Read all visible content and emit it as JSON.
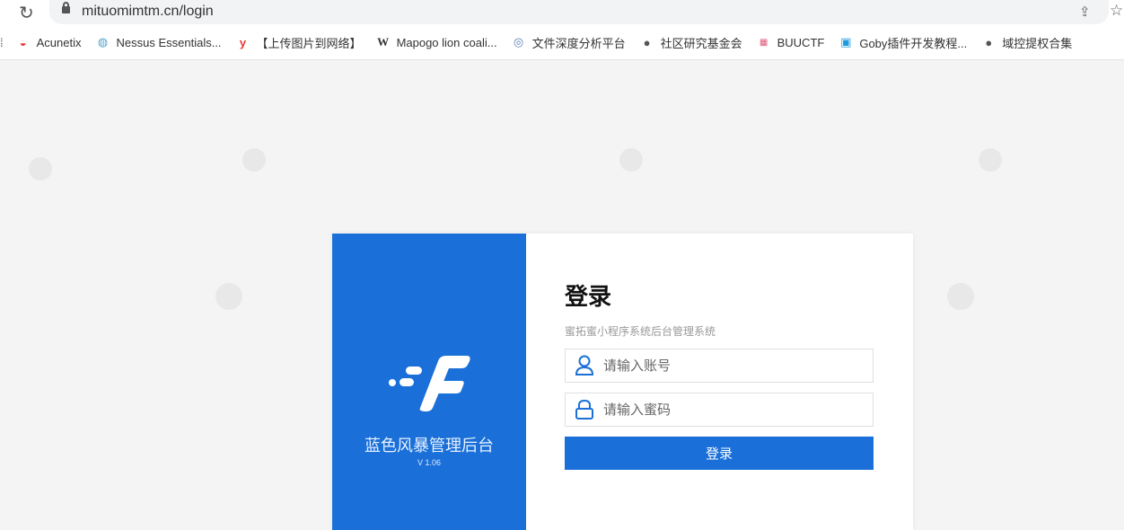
{
  "browser": {
    "url": "mituomimtm.cn/login"
  },
  "bookmarks": [
    {
      "label": "Acunetix",
      "icon": "acunetix-icon",
      "glyph": "◒",
      "color": "#e53935"
    },
    {
      "label": "Nessus Essentials...",
      "icon": "nessus-icon",
      "glyph": "◍",
      "color": "#4fa3d1"
    },
    {
      "label": "【上传图片到网络】",
      "icon": "y-icon",
      "glyph": "y",
      "color": "#e53935"
    },
    {
      "label": "Mapogo lion coali...",
      "icon": "wikipedia-icon",
      "glyph": "W",
      "color": "#333"
    },
    {
      "label": "文件深度分析平台",
      "icon": "eye-icon",
      "glyph": "◎",
      "color": "#5b7fb5"
    },
    {
      "label": "社区研究基金会",
      "icon": "globe-icon",
      "glyph": "●",
      "color": "#555"
    },
    {
      "label": "BUUCTF",
      "icon": "buuctf-icon",
      "glyph": "▦",
      "color": "#e05a7a"
    },
    {
      "label": "Goby插件开发教程...",
      "icon": "bilibili-icon",
      "glyph": "▣",
      "color": "#1e9be0"
    },
    {
      "label": "域控提权合集",
      "icon": "globe-icon",
      "glyph": "●",
      "color": "#555"
    }
  ],
  "login": {
    "brand": "蓝色风暴管理后台",
    "version": "V 1.06",
    "title": "登录",
    "subtitle": "蜜拓蜜小程序系统后台管理系统",
    "username_placeholder": "请输入账号",
    "password_placeholder": "请输入蜜码",
    "submit": "登录"
  },
  "colors": {
    "brand": "#1a70d8"
  }
}
